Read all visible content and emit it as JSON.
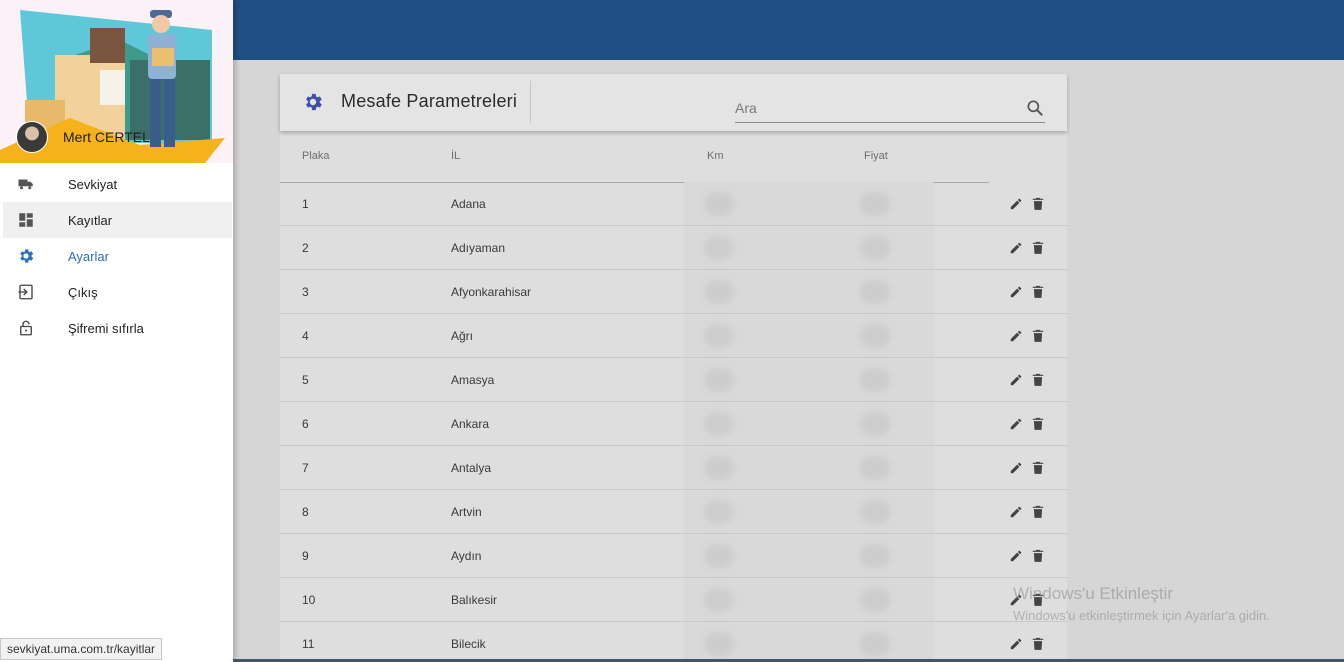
{
  "drawer": {
    "user_name": "Mert CERTEL",
    "items": [
      {
        "label": "Sevkiyat",
        "icon": "truck-icon"
      },
      {
        "label": "Kayıtlar",
        "icon": "dashboard-icon"
      },
      {
        "label": "Ayarlar",
        "icon": "gear-icon"
      },
      {
        "label": "Çıkış",
        "icon": "exit-icon"
      },
      {
        "label": "Şifremi sıfırla",
        "icon": "lock-icon"
      }
    ],
    "active_color": "#2a6fc0"
  },
  "card": {
    "title": "Mesafe Parametreleri",
    "search_placeholder": "Ara",
    "columns": {
      "plaka": "Plaka",
      "il": "İL",
      "km": "Km",
      "fiyat": "Fiyat"
    },
    "rows": [
      {
        "plaka": "1",
        "il": "Adana"
      },
      {
        "plaka": "2",
        "il": "Adıyaman"
      },
      {
        "plaka": "3",
        "il": "Afyonkarahisar"
      },
      {
        "plaka": "4",
        "il": "Ağrı"
      },
      {
        "plaka": "5",
        "il": "Amasya"
      },
      {
        "plaka": "6",
        "il": "Ankara"
      },
      {
        "plaka": "7",
        "il": "Antalya"
      },
      {
        "plaka": "8",
        "il": "Artvin"
      },
      {
        "plaka": "9",
        "il": "Aydın"
      },
      {
        "plaka": "10",
        "il": "Balıkesir"
      },
      {
        "plaka": "11",
        "il": "Bilecik"
      }
    ]
  },
  "status_url": "sevkiyat.uma.com.tr/kayitlar",
  "watermark": {
    "title": "Windows'u Etkinleştir",
    "subtitle": "Windows'u etkinleştirmek için Ayarlar'a gidin."
  },
  "colors": {
    "appbar": "#1f4f84",
    "accent": "#2a6fc0"
  }
}
